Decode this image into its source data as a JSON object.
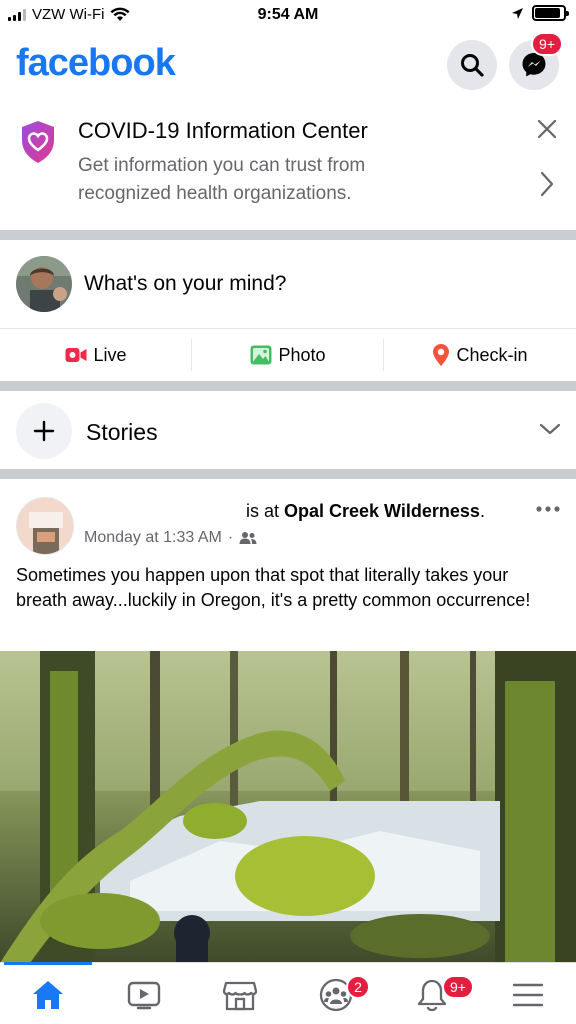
{
  "status_bar": {
    "carrier": "VZW Wi-Fi",
    "time": "9:54 AM",
    "battery_level": 0.9
  },
  "header": {
    "brand": "facebook",
    "messenger_badge": "9+"
  },
  "covid_card": {
    "title": "COVID-19 Information Center",
    "description": "Get information you can trust from recognized health organizations."
  },
  "composer": {
    "prompt": "What's on your mind?"
  },
  "actions": [
    {
      "label": "Live",
      "icon": "live-video-icon",
      "color": "#f02849"
    },
    {
      "label": "Photo",
      "icon": "photo-icon",
      "color": "#45bd62"
    },
    {
      "label": "Check-in",
      "icon": "location-pin-icon",
      "color": "#f5533d"
    }
  ],
  "stories": {
    "label": "Stories"
  },
  "post": {
    "prefix": "is at ",
    "place": "Opal Creek Wilderness",
    "suffix": ".",
    "timestamp": "Monday at 1:33 AM",
    "separator": "·",
    "text": "Sometimes you happen upon that spot that literally takes your breath away...luckily in Oregon, it's a pretty common occurrence!"
  },
  "tabbar": {
    "groups_badge": "2",
    "notifications_badge": "9+",
    "active_tab": "home"
  },
  "colors": {
    "brand": "#1877f2",
    "badge": "#e41e3f",
    "secondary_text": "#65676b",
    "divider": "#c9ccd1"
  }
}
